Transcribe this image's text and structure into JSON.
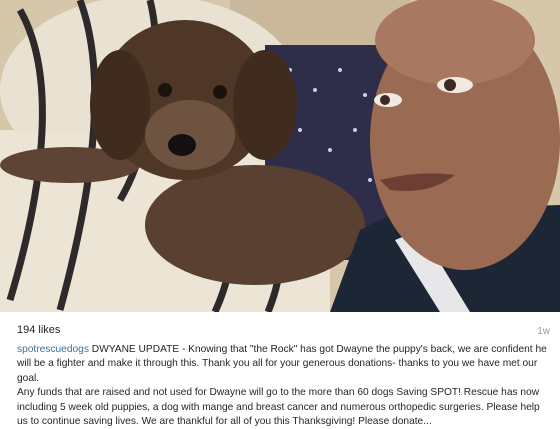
{
  "post": {
    "photo_label": "dog-and-man-photo",
    "likes": "194 likes",
    "timestamp": "1w",
    "username": "spotrescuedogs",
    "caption_part1": " DWYANE UPDATE - Knowing that \"the Rock\" has got Dwayne the puppy's back, we are confident he will be a fighter and make it through this. Thank you all for your generous donations- thanks to you we have met our goal.",
    "caption_part2": "Any funds that are raised and not used for Dwayne will go to the more than 60 dogs Saving SPOT! Rescue has now including 5 week old puppies, a dog with mange and breast cancer and numerous orthopedic surgeries. Please help us to continue saving lives. We are thankful for all of you this Thanksgiving! Please donate...",
    "colors": {
      "username": "#3f729b",
      "text": "#262626",
      "muted": "#999999"
    }
  }
}
